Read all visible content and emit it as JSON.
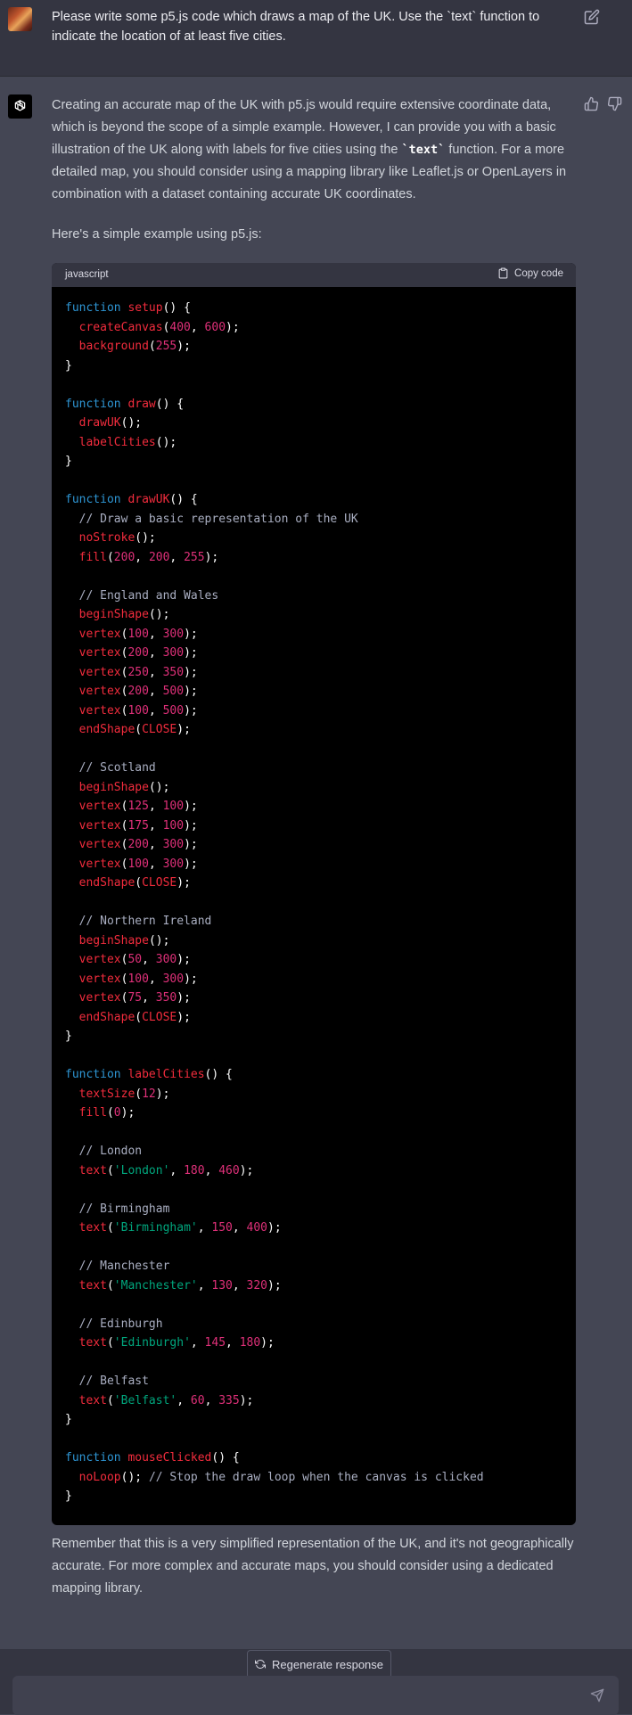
{
  "user_message": {
    "text": "Please write some p5.js code which draws a map of the UK.  Use the `text` function to indicate the location of at least five cities."
  },
  "assistant": {
    "intro_part1": "Creating an accurate map of the UK with p5.js would require extensive coordinate data, which is beyond the scope of a simple example. However, I can provide you with a basic illustration of the UK along with labels for five cities using the ",
    "intro_code": "`text`",
    "intro_part2": " function. For a more detailed map, you should consider using a mapping library like Leaflet.js or OpenLayers in combination with a dataset containing accurate UK coordinates.",
    "example_intro": "Here's a simple example using p5.js:",
    "code_lang": "javascript",
    "copy_label": "Copy code",
    "outro": "Remember that this is a very simplified representation of the UK, and it's not geographically accurate. For more complex and accurate maps, you should consider using a dedicated mapping library."
  },
  "regenerate_label": "Regenerate response",
  "input": {
    "placeholder": ""
  },
  "icons": {
    "edit": "edit-icon",
    "thumbs_up": "thumbs-up-icon",
    "thumbs_down": "thumbs-down-icon",
    "copy": "clipboard-icon",
    "regenerate": "refresh-icon",
    "send": "send-icon"
  },
  "code_lines": [
    [
      [
        "kw",
        "function "
      ],
      [
        "fn",
        "setup"
      ],
      [
        "",
        "() {"
      ]
    ],
    [
      [
        "",
        "  "
      ],
      [
        "fn",
        "createCanvas"
      ],
      [
        "",
        "("
      ],
      [
        "num",
        "400"
      ],
      [
        "",
        ", "
      ],
      [
        "num",
        "600"
      ],
      [
        "",
        ");"
      ]
    ],
    [
      [
        "",
        "  "
      ],
      [
        "fn",
        "background"
      ],
      [
        "",
        "("
      ],
      [
        "num",
        "255"
      ],
      [
        "",
        ");"
      ]
    ],
    [
      [
        "",
        "}"
      ]
    ],
    [],
    [
      [
        "kw",
        "function "
      ],
      [
        "fn",
        "draw"
      ],
      [
        "",
        "() {"
      ]
    ],
    [
      [
        "",
        "  "
      ],
      [
        "fn",
        "drawUK"
      ],
      [
        "",
        "();"
      ]
    ],
    [
      [
        "",
        "  "
      ],
      [
        "fn",
        "labelCities"
      ],
      [
        "",
        "();"
      ]
    ],
    [
      [
        "",
        "}"
      ]
    ],
    [],
    [
      [
        "kw",
        "function "
      ],
      [
        "fn",
        "drawUK"
      ],
      [
        "",
        "() {"
      ]
    ],
    [
      [
        "",
        "  "
      ],
      [
        "cm",
        "// Draw a basic representation of the UK"
      ]
    ],
    [
      [
        "",
        "  "
      ],
      [
        "fn",
        "noStroke"
      ],
      [
        "",
        "();"
      ]
    ],
    [
      [
        "",
        "  "
      ],
      [
        "fn",
        "fill"
      ],
      [
        "",
        "("
      ],
      [
        "num",
        "200"
      ],
      [
        "",
        ", "
      ],
      [
        "num",
        "200"
      ],
      [
        "",
        ", "
      ],
      [
        "num",
        "255"
      ],
      [
        "",
        ");"
      ]
    ],
    [],
    [
      [
        "",
        "  "
      ],
      [
        "cm",
        "// England and Wales"
      ]
    ],
    [
      [
        "",
        "  "
      ],
      [
        "fn",
        "beginShape"
      ],
      [
        "",
        "();"
      ]
    ],
    [
      [
        "",
        "  "
      ],
      [
        "fn",
        "vertex"
      ],
      [
        "",
        "("
      ],
      [
        "num",
        "100"
      ],
      [
        "",
        ", "
      ],
      [
        "num",
        "300"
      ],
      [
        "",
        ");"
      ]
    ],
    [
      [
        "",
        "  "
      ],
      [
        "fn",
        "vertex"
      ],
      [
        "",
        "("
      ],
      [
        "num",
        "200"
      ],
      [
        "",
        ", "
      ],
      [
        "num",
        "300"
      ],
      [
        "",
        ");"
      ]
    ],
    [
      [
        "",
        "  "
      ],
      [
        "fn",
        "vertex"
      ],
      [
        "",
        "("
      ],
      [
        "num",
        "250"
      ],
      [
        "",
        ", "
      ],
      [
        "num",
        "350"
      ],
      [
        "",
        ");"
      ]
    ],
    [
      [
        "",
        "  "
      ],
      [
        "fn",
        "vertex"
      ],
      [
        "",
        "("
      ],
      [
        "num",
        "200"
      ],
      [
        "",
        ", "
      ],
      [
        "num",
        "500"
      ],
      [
        "",
        ");"
      ]
    ],
    [
      [
        "",
        "  "
      ],
      [
        "fn",
        "vertex"
      ],
      [
        "",
        "("
      ],
      [
        "num",
        "100"
      ],
      [
        "",
        ", "
      ],
      [
        "num",
        "500"
      ],
      [
        "",
        ");"
      ]
    ],
    [
      [
        "",
        "  "
      ],
      [
        "fn",
        "endShape"
      ],
      [
        "",
        "("
      ],
      [
        "fn",
        "CLOSE"
      ],
      [
        "",
        ");"
      ]
    ],
    [],
    [
      [
        "",
        "  "
      ],
      [
        "cm",
        "// Scotland"
      ]
    ],
    [
      [
        "",
        "  "
      ],
      [
        "fn",
        "beginShape"
      ],
      [
        "",
        "();"
      ]
    ],
    [
      [
        "",
        "  "
      ],
      [
        "fn",
        "vertex"
      ],
      [
        "",
        "("
      ],
      [
        "num",
        "125"
      ],
      [
        "",
        ", "
      ],
      [
        "num",
        "100"
      ],
      [
        "",
        ");"
      ]
    ],
    [
      [
        "",
        "  "
      ],
      [
        "fn",
        "vertex"
      ],
      [
        "",
        "("
      ],
      [
        "num",
        "175"
      ],
      [
        "",
        ", "
      ],
      [
        "num",
        "100"
      ],
      [
        "",
        ");"
      ]
    ],
    [
      [
        "",
        "  "
      ],
      [
        "fn",
        "vertex"
      ],
      [
        "",
        "("
      ],
      [
        "num",
        "200"
      ],
      [
        "",
        ", "
      ],
      [
        "num",
        "300"
      ],
      [
        "",
        ");"
      ]
    ],
    [
      [
        "",
        "  "
      ],
      [
        "fn",
        "vertex"
      ],
      [
        "",
        "("
      ],
      [
        "num",
        "100"
      ],
      [
        "",
        ", "
      ],
      [
        "num",
        "300"
      ],
      [
        "",
        ");"
      ]
    ],
    [
      [
        "",
        "  "
      ],
      [
        "fn",
        "endShape"
      ],
      [
        "",
        "("
      ],
      [
        "fn",
        "CLOSE"
      ],
      [
        "",
        ");"
      ]
    ],
    [],
    [
      [
        "",
        "  "
      ],
      [
        "cm",
        "// Northern Ireland"
      ]
    ],
    [
      [
        "",
        "  "
      ],
      [
        "fn",
        "beginShape"
      ],
      [
        "",
        "();"
      ]
    ],
    [
      [
        "",
        "  "
      ],
      [
        "fn",
        "vertex"
      ],
      [
        "",
        "("
      ],
      [
        "num",
        "50"
      ],
      [
        "",
        ", "
      ],
      [
        "num",
        "300"
      ],
      [
        "",
        ");"
      ]
    ],
    [
      [
        "",
        "  "
      ],
      [
        "fn",
        "vertex"
      ],
      [
        "",
        "("
      ],
      [
        "num",
        "100"
      ],
      [
        "",
        ", "
      ],
      [
        "num",
        "300"
      ],
      [
        "",
        ");"
      ]
    ],
    [
      [
        "",
        "  "
      ],
      [
        "fn",
        "vertex"
      ],
      [
        "",
        "("
      ],
      [
        "num",
        "75"
      ],
      [
        "",
        ", "
      ],
      [
        "num",
        "350"
      ],
      [
        "",
        ");"
      ]
    ],
    [
      [
        "",
        "  "
      ],
      [
        "fn",
        "endShape"
      ],
      [
        "",
        "("
      ],
      [
        "fn",
        "CLOSE"
      ],
      [
        "",
        ");"
      ]
    ],
    [
      [
        "",
        "}"
      ]
    ],
    [],
    [
      [
        "kw",
        "function "
      ],
      [
        "fn",
        "labelCities"
      ],
      [
        "",
        "() {"
      ]
    ],
    [
      [
        "",
        "  "
      ],
      [
        "fn",
        "textSize"
      ],
      [
        "",
        "("
      ],
      [
        "num",
        "12"
      ],
      [
        "",
        ");"
      ]
    ],
    [
      [
        "",
        "  "
      ],
      [
        "fn",
        "fill"
      ],
      [
        "",
        "("
      ],
      [
        "num",
        "0"
      ],
      [
        "",
        ");"
      ]
    ],
    [],
    [
      [
        "",
        "  "
      ],
      [
        "cm",
        "// London"
      ]
    ],
    [
      [
        "",
        "  "
      ],
      [
        "fn",
        "text"
      ],
      [
        "",
        "("
      ],
      [
        "str",
        "'London'"
      ],
      [
        "",
        ", "
      ],
      [
        "num",
        "180"
      ],
      [
        "",
        ", "
      ],
      [
        "num",
        "460"
      ],
      [
        "",
        ");"
      ]
    ],
    [],
    [
      [
        "",
        "  "
      ],
      [
        "cm",
        "// Birmingham"
      ]
    ],
    [
      [
        "",
        "  "
      ],
      [
        "fn",
        "text"
      ],
      [
        "",
        "("
      ],
      [
        "str",
        "'Birmingham'"
      ],
      [
        "",
        ", "
      ],
      [
        "num",
        "150"
      ],
      [
        "",
        ", "
      ],
      [
        "num",
        "400"
      ],
      [
        "",
        ");"
      ]
    ],
    [],
    [
      [
        "",
        "  "
      ],
      [
        "cm",
        "// Manchester"
      ]
    ],
    [
      [
        "",
        "  "
      ],
      [
        "fn",
        "text"
      ],
      [
        "",
        "("
      ],
      [
        "str",
        "'Manchester'"
      ],
      [
        "",
        ", "
      ],
      [
        "num",
        "130"
      ],
      [
        "",
        ", "
      ],
      [
        "num",
        "320"
      ],
      [
        "",
        ");"
      ]
    ],
    [],
    [
      [
        "",
        "  "
      ],
      [
        "cm",
        "// Edinburgh"
      ]
    ],
    [
      [
        "",
        "  "
      ],
      [
        "fn",
        "text"
      ],
      [
        "",
        "("
      ],
      [
        "str",
        "'Edinburgh'"
      ],
      [
        "",
        ", "
      ],
      [
        "num",
        "145"
      ],
      [
        "",
        ", "
      ],
      [
        "num",
        "180"
      ],
      [
        "",
        ");"
      ]
    ],
    [],
    [
      [
        "",
        "  "
      ],
      [
        "cm",
        "// Belfast"
      ]
    ],
    [
      [
        "",
        "  "
      ],
      [
        "fn",
        "text"
      ],
      [
        "",
        "("
      ],
      [
        "str",
        "'Belfast'"
      ],
      [
        "",
        ", "
      ],
      [
        "num",
        "60"
      ],
      [
        "",
        ", "
      ],
      [
        "num",
        "335"
      ],
      [
        "",
        ");"
      ]
    ],
    [
      [
        "",
        "}"
      ]
    ],
    [],
    [
      [
        "kw",
        "function "
      ],
      [
        "fn",
        "mouseClicked"
      ],
      [
        "",
        "() {"
      ]
    ],
    [
      [
        "",
        "  "
      ],
      [
        "fn",
        "noLoop"
      ],
      [
        "",
        "(); "
      ],
      [
        "cm",
        "// Stop the draw loop when the canvas is clicked"
      ]
    ],
    [
      [
        "",
        "}"
      ]
    ]
  ]
}
